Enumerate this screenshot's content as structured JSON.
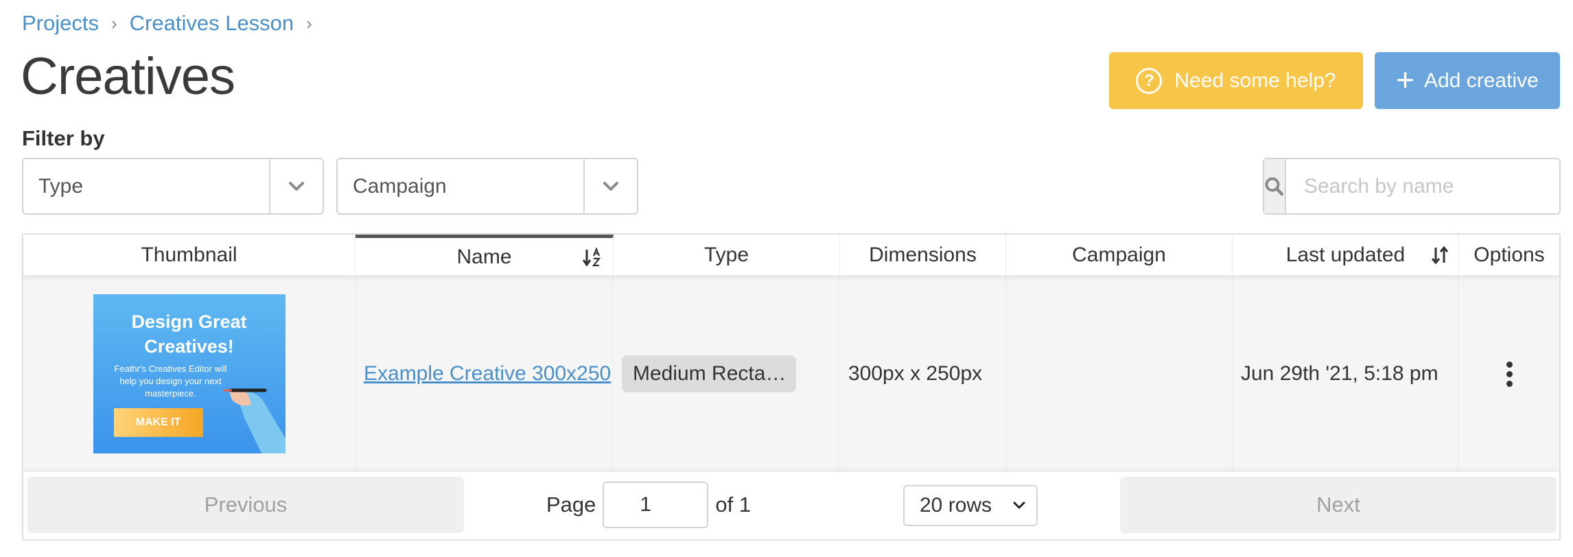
{
  "breadcrumb": {
    "items": [
      "Projects",
      "Creatives Lesson"
    ],
    "separator": "›"
  },
  "page": {
    "title": "Creatives"
  },
  "actions": {
    "help_label": "Need some help?",
    "help_icon": "?",
    "add_label": "Add creative",
    "add_icon": "+"
  },
  "filters": {
    "label": "Filter by",
    "type_value": "Type",
    "campaign_value": "Campaign",
    "search_placeholder": "Search by name"
  },
  "table": {
    "columns": {
      "thumbnail": "Thumbnail",
      "name": "Name",
      "type": "Type",
      "dimensions": "Dimensions",
      "campaign": "Campaign",
      "last_updated": "Last updated",
      "options": "Options"
    },
    "sorted_column": "name",
    "rows": [
      {
        "thumbnail": {
          "headline_1": "Design Great",
          "headline_2": "Creatives!",
          "subtext": "Feathr's Creatives Editor will help you design your next masterpiece.",
          "cta": "MAKE IT"
        },
        "name": "Example Creative 300x250",
        "type": "Medium Recta…",
        "dimensions": "300px x 250px",
        "campaign": "",
        "last_updated": "Jun 29th '21, 5:18 pm"
      }
    ]
  },
  "pagination": {
    "previous_label": "Previous",
    "next_label": "Next",
    "page_label": "Page",
    "current_page": "1",
    "of_label": "of 1",
    "rows_value": "20 rows"
  },
  "colors": {
    "link": "#4a90c8",
    "help_button": "#f7c548",
    "add_button": "#6aa6dd"
  }
}
